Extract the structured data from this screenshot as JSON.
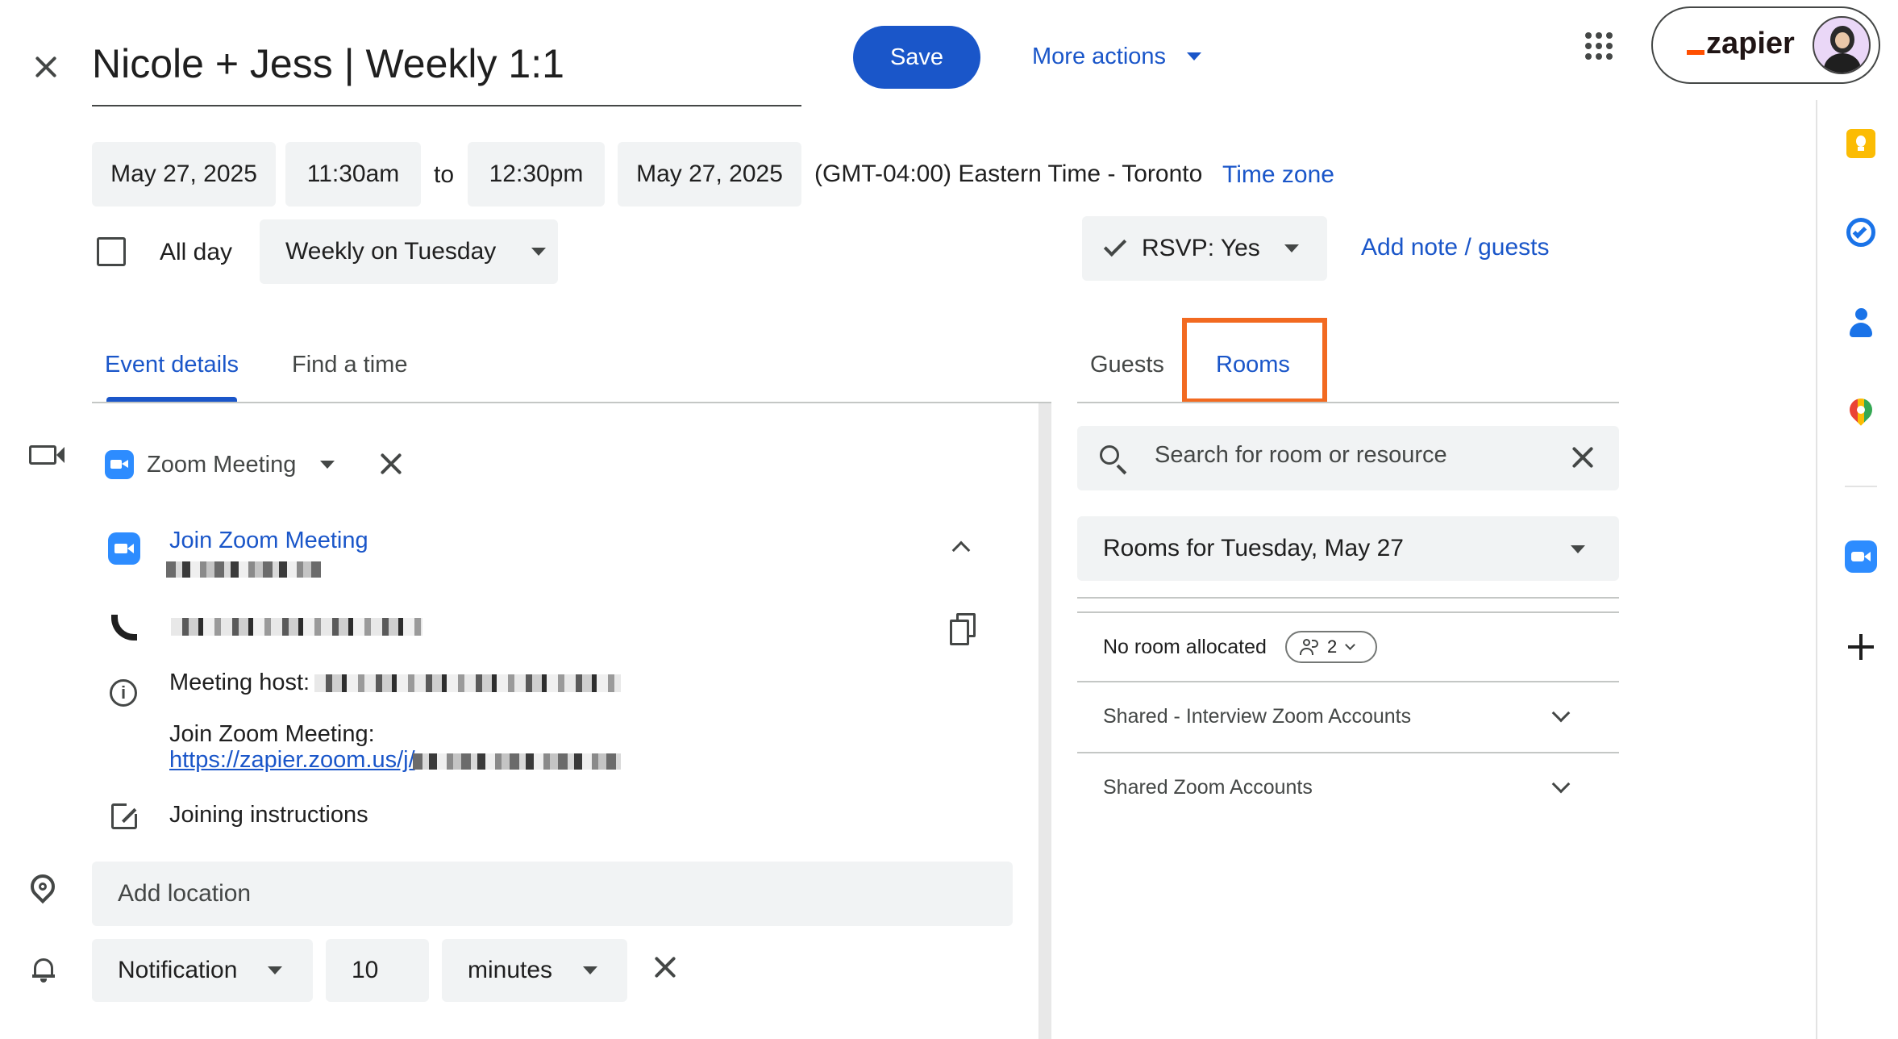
{
  "header": {
    "title": "Nicole + Jess | Weekly 1:1",
    "save_label": "Save",
    "more_actions_label": "More actions",
    "brand_label": "zapier"
  },
  "datetime": {
    "start_date": "May 27, 2025",
    "start_time": "11:30am",
    "to_label": "to",
    "end_time": "12:30pm",
    "end_date": "May 27, 2025",
    "timezone_text": "(GMT-04:00) Eastern Time - Toronto",
    "timezone_link": "Time zone",
    "all_day_label": "All day",
    "all_day_checked": false,
    "recurrence": "Weekly on Tuesday",
    "rsvp_label": "RSVP: Yes",
    "add_note_label": "Add note / guests"
  },
  "left_tabs": [
    {
      "label": "Event details",
      "active": true
    },
    {
      "label": "Find a time",
      "active": false
    }
  ],
  "right_tabs": [
    {
      "label": "Guests",
      "active": false
    },
    {
      "label": "Rooms",
      "active": true
    }
  ],
  "conference": {
    "provider_label": "Zoom Meeting",
    "join_label": "Join Zoom Meeting",
    "host_label": "Meeting host:",
    "join_meeting_label": "Join Zoom Meeting:",
    "join_url": "https://zapier.zoom.us/j/",
    "instructions_label": "Joining instructions"
  },
  "location": {
    "placeholder": "Add location"
  },
  "notification": {
    "type": "Notification",
    "amount": "10",
    "unit": "minutes"
  },
  "rooms": {
    "search_placeholder": "Search for room or resource",
    "date_filter": "Rooms for Tuesday, May 27",
    "no_room_label": "No room allocated",
    "guest_count": "2",
    "groups": [
      {
        "label": "Shared - Interview Zoom Accounts"
      },
      {
        "label": "Shared Zoom Accounts"
      }
    ]
  },
  "colors": {
    "accent": "#1a56c9",
    "highlight_box": "#f26a21",
    "chip_bg": "#f1f3f4",
    "keep_yellow": "#fbbc04",
    "tasks_blue": "#1a73e8",
    "zoom_blue": "#2d8cff"
  }
}
